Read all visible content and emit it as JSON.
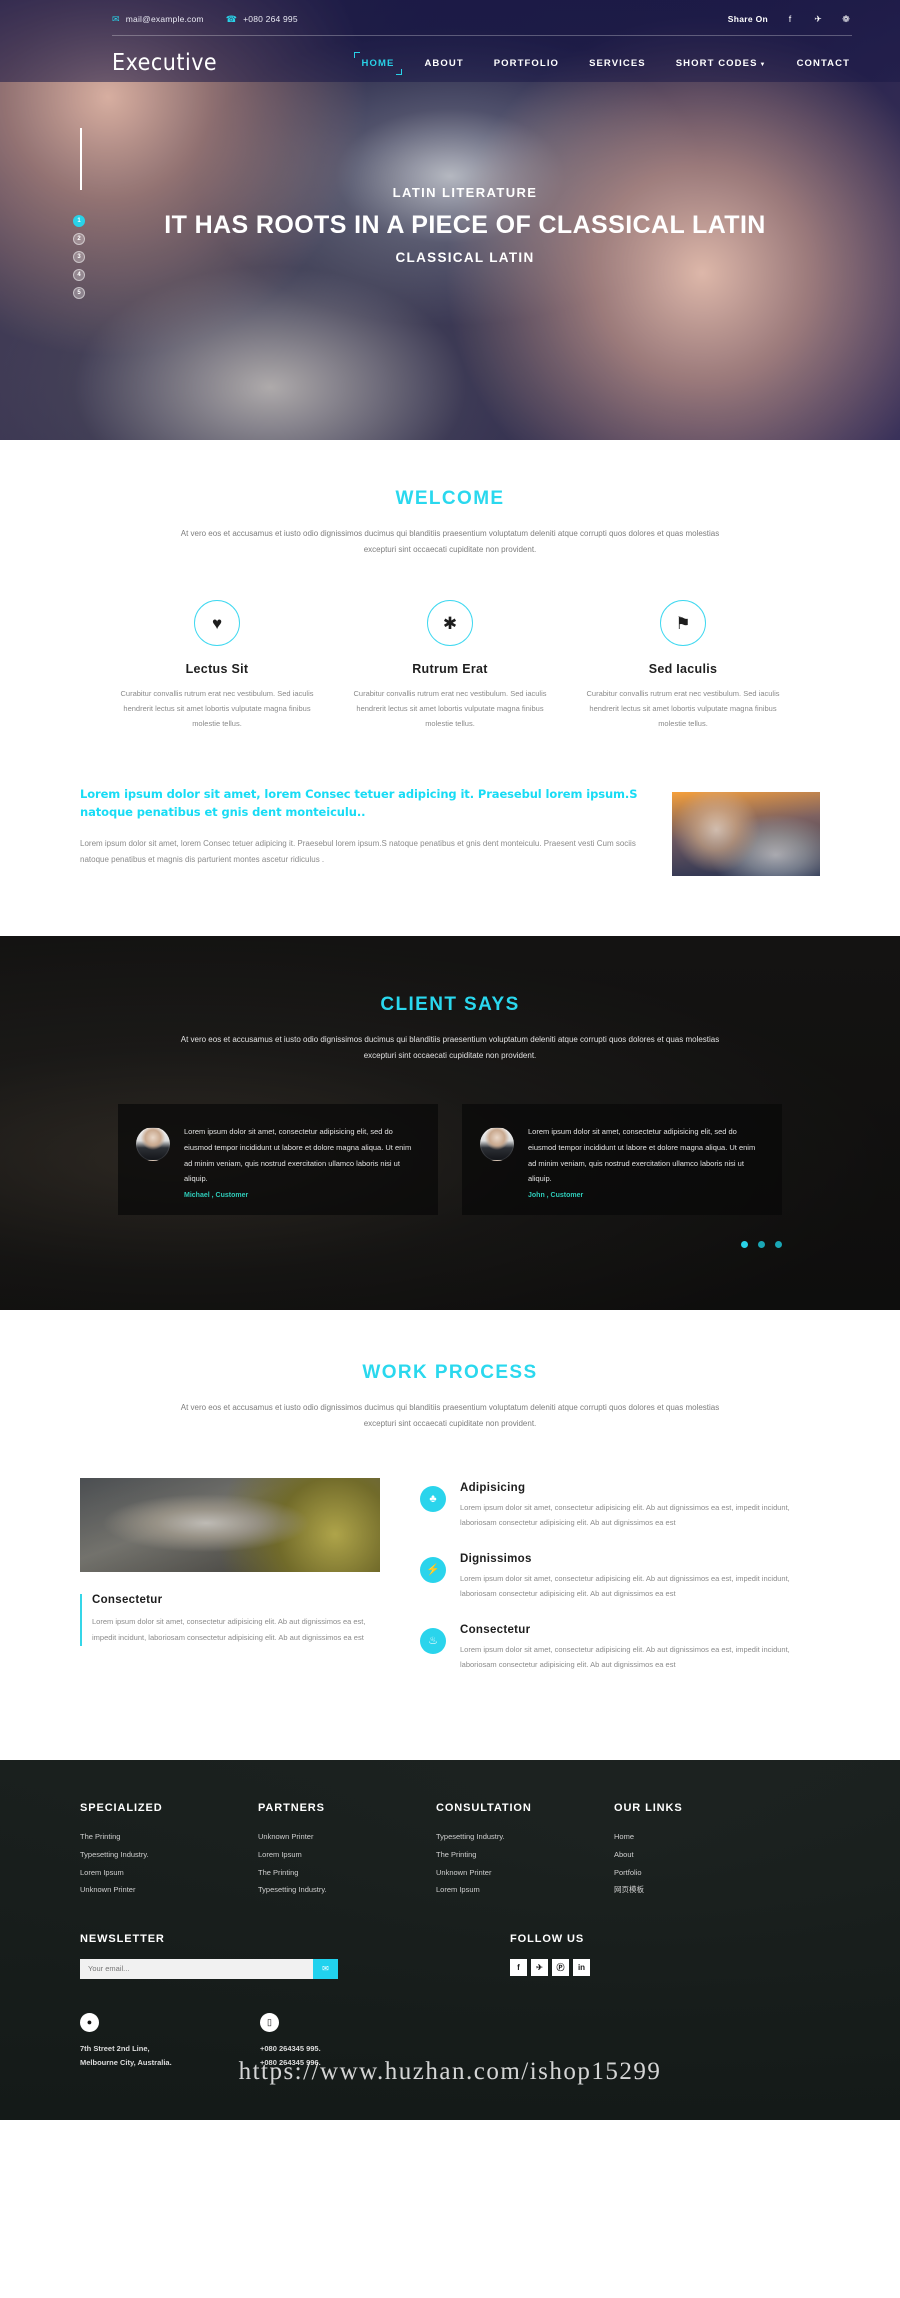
{
  "topbar": {
    "email": "mail@example.com",
    "email_icon": "envelope-icon",
    "phone": "+080 264 995",
    "phone_icon": "phone-icon",
    "share_label": "Share On",
    "socials": [
      {
        "name": "facebook-icon",
        "glyph": "f"
      },
      {
        "name": "twitter-icon",
        "glyph": "✈"
      },
      {
        "name": "dribbble-icon",
        "glyph": "❁"
      }
    ]
  },
  "brand": {
    "name": "Executive"
  },
  "nav": {
    "items": [
      {
        "label": "HOME",
        "active": true,
        "caret": false
      },
      {
        "label": "ABOUT",
        "active": false,
        "caret": false
      },
      {
        "label": "PORTFOLIO",
        "active": false,
        "caret": false
      },
      {
        "label": "SERVICES",
        "active": false,
        "caret": false
      },
      {
        "label": "SHORT CODES",
        "active": false,
        "caret": true
      },
      {
        "label": "CONTACT",
        "active": false,
        "caret": false
      }
    ]
  },
  "hero": {
    "kicker": "LATIN LITERATURE",
    "title": "IT HAS ROOTS IN A PIECE OF CLASSICAL LATIN",
    "subtitle": "CLASSICAL LATIN",
    "slide_numbers": [
      "1",
      "2",
      "3",
      "4",
      "5"
    ],
    "active_slide": "1"
  },
  "welcome": {
    "title": "WELCOME",
    "lead": "At vero eos et accusamus et iusto odio dignissimos ducimus qui blanditiis praesentium voluptatum deleniti atque corrupti quos dolores et quas molestias excepturi sint occaecati cupiditate non provident.",
    "features": [
      {
        "icon": "heart-icon",
        "glyph": "♥",
        "title": "Lectus Sit",
        "text": "Curabitur convallis rutrum erat nec vestibulum. Sed iaculis hendrerit lectus sit amet lobortis vulputate magna finibus molestie tellus."
      },
      {
        "icon": "asterisk-icon",
        "glyph": "✱",
        "title": "Rutrum Erat",
        "text": "Curabitur convallis rutrum erat nec vestibulum. Sed iaculis hendrerit lectus sit amet lobortis vulputate magna finibus molestie tellus."
      },
      {
        "icon": "flag-icon",
        "glyph": "⚑",
        "title": "Sed Iaculis",
        "text": "Curabitur convallis rutrum erat nec vestibulum. Sed iaculis hendrerit lectus sit amet lobortis vulputate magna finibus molestie tellus."
      }
    ]
  },
  "promo": {
    "heading": "Lorem ipsum dolor sit amet, lorem Consec tetuer adipicing it. Praesebul lorem ipsum.S natoque penatibus et gnis dent monteiculu..",
    "body": "Lorem ipsum dolor sit amet, lorem Consec tetuer adipicing it. Praesebul lorem ipsum.S natoque penatibus et gnis dent monteiculu. Praesent vesti Cum sociis natoque penatibus et magnis dis parturient montes ascetur ridiculus .",
    "image_name": "businesswoman-presentation-photo"
  },
  "clients": {
    "title": "CLIENT SAYS",
    "lead": "At vero eos et accusamus et iusto odio dignissimos ducimus qui blanditiis praesentium voluptatum deleniti atque corrupti quos dolores et quas molestias excepturi sint occaecati cupiditate non provident.",
    "testimonials": [
      {
        "avatar": "female-customer-avatar",
        "text": "Lorem ipsum dolor sit amet, consectetur adipisicing elit, sed do eiusmod tempor incididunt ut labore et dolore magna aliqua. Ut enim ad minim veniam, quis nostrud exercitation ullamco laboris nisi ut aliquip.",
        "author": "Michael , Customer"
      },
      {
        "avatar": "male-customer-avatar",
        "text": "Lorem ipsum dolor sit amet, consectetur adipisicing elit, sed do eiusmod tempor incididunt ut labore et dolore magna aliqua. Ut enim ad minim veniam, quis nostrud exercitation ullamco laboris nisi ut aliquip.",
        "author": "John , Customer"
      }
    ],
    "dots": 3,
    "active_dot": 0
  },
  "work": {
    "title": "WORK PROCESS",
    "lead": "At vero eos et accusamus et iusto odio dignissimos ducimus qui blanditiis praesentium voluptatum deleniti atque corrupti quos dolores et quas molestias excepturi sint occaecati cupiditate non provident.",
    "image_name": "workshop-photo",
    "caption": {
      "title": "Consectetur",
      "text": "Lorem ipsum dolor sit amet, consectetur adipisicing elit. Ab aut dignissimos ea est, impedit incidunt, laboriosam consectetur adipisicing elit. Ab aut dignissimos ea est"
    },
    "steps": [
      {
        "icon": "tree-icon",
        "glyph": "♣",
        "title": "Adipisicing",
        "text": "Lorem ipsum dolor sit amet, consectetur adipisicing elit. Ab aut dignissimos ea est, impedit incidunt, laboriosam consectetur adipisicing elit. Ab aut dignissimos ea est"
      },
      {
        "icon": "bolt-icon",
        "glyph": "⚡",
        "title": "Dignissimos",
        "text": "Lorem ipsum dolor sit amet, consectetur adipisicing elit. Ab aut dignissimos ea est, impedit incidunt, laboriosam consectetur adipisicing elit. Ab aut dignissimos ea est"
      },
      {
        "icon": "fire-icon",
        "glyph": "♨",
        "title": "Consectetur",
        "text": "Lorem ipsum dolor sit amet, consectetur adipisicing elit. Ab aut dignissimos ea est, impedit incidunt, laboriosam consectetur adipisicing elit. Ab aut dignissimos ea est"
      }
    ]
  },
  "footer": {
    "columns": [
      {
        "heading": "SPECIALIZED",
        "items": [
          "The Printing",
          "Typesetting Industry.",
          "Lorem Ipsum",
          "Unknown Printer"
        ]
      },
      {
        "heading": "PARTNERS",
        "items": [
          "Unknown Printer",
          "Lorem Ipsum",
          "The Printing",
          "Typesetting Industry."
        ]
      },
      {
        "heading": "CONSULTATION",
        "items": [
          "Typesetting Industry.",
          "The Printing",
          "Unknown Printer",
          "Lorem Ipsum"
        ]
      },
      {
        "heading": "OUR LINKS",
        "items": [
          "Home",
          "About",
          "Portfolio",
          "网页模板"
        ]
      }
    ],
    "newsletter": {
      "heading": "NEWSLETTER",
      "placeholder": "Your email...",
      "value": "",
      "submit_icon": "envelope-icon"
    },
    "follow": {
      "heading": "FOLLOW US",
      "socials": [
        {
          "name": "facebook-icon",
          "glyph": "f"
        },
        {
          "name": "twitter-icon",
          "glyph": "✈"
        },
        {
          "name": "pinterest-icon",
          "glyph": "Ⓟ"
        },
        {
          "name": "linkedin-icon",
          "glyph": "in"
        }
      ]
    },
    "contact": [
      {
        "icon": "location-pin-icon",
        "glyph": "◉",
        "line1": "7th Street 2nd Line,",
        "line2": "Melbourne City, Australia."
      },
      {
        "icon": "mobile-phone-icon",
        "glyph": "☎",
        "line1": "+080 264345 995.",
        "line2": "+080 264345 996."
      }
    ],
    "watermark": "https://www.huzhan.com/ishop15299"
  },
  "colors": {
    "accent": "#2ad8ee",
    "accent_dark": "#18dcf5",
    "testimonial_author": "#2ecbb8"
  }
}
